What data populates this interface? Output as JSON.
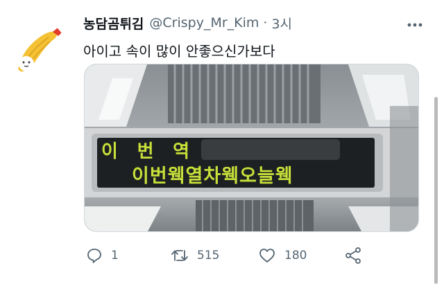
{
  "tweet": {
    "display_name": "농담곰튀김",
    "handle": "@Crispy_Mr_Kim",
    "separator": "·",
    "time": "3시",
    "text": "아이고 속이 많이 안좋으신가보다",
    "media": {
      "sign_line1": "이 번 역",
      "sign_line2": "이번웩열차웩오늘웩"
    },
    "actions": {
      "reply_count": "1",
      "retweet_count": "515",
      "like_count": "180"
    }
  },
  "colors": {
    "text_primary": "#0f1419",
    "text_secondary": "#536471",
    "led_green": "#c8e03a",
    "avatar_bg": "#ffd83a"
  },
  "icons": [
    "more-icon",
    "reply-icon",
    "retweet-icon",
    "like-icon",
    "share-icon"
  ]
}
